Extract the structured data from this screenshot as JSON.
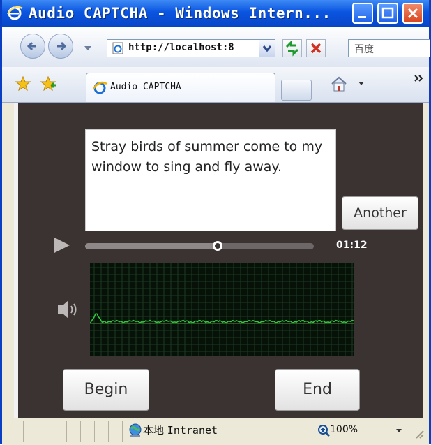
{
  "window": {
    "title": "Audio CAPTCHA - Windows Intern..."
  },
  "nav": {
    "address": "http://localhost:8",
    "search_placeholder": "百度"
  },
  "tabs": [
    {
      "label": "Audio CAPTCHA"
    }
  ],
  "captcha": {
    "text": "Stray birds of summer come to my window to sing and fly away.",
    "another_label": "Another",
    "time": "01:12",
    "progress": 0.58,
    "begin_label": "Begin",
    "end_label": "End"
  },
  "status": {
    "zone": "本地",
    "zone_suffix": "Intranet",
    "zoom": "100%"
  },
  "colors": {
    "player_background": "#3b3232",
    "waveform": "#2ecc40",
    "titlebar": "#0a55e0"
  }
}
